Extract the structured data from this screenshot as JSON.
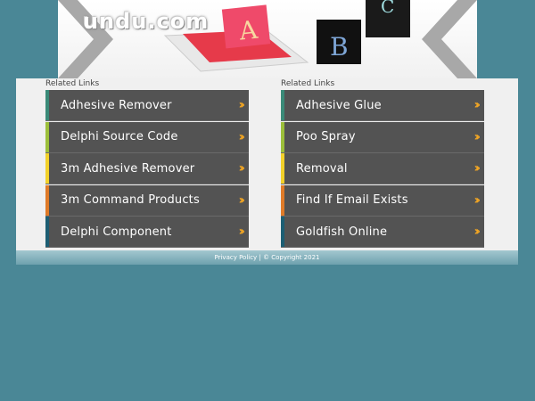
{
  "header": {
    "logo_text": "undu.com",
    "image_letters": [
      "A",
      "B",
      "C"
    ]
  },
  "columns": [
    {
      "label": "Related Links",
      "items": [
        {
          "label": "Adhesive Remover",
          "accent": "#3a8a78"
        },
        {
          "label": "Delphi Source Code",
          "accent": "#9cbf3a"
        },
        {
          "label": "3m Adhesive Remover",
          "accent": "#f2d12a"
        },
        {
          "label": "3m Command Products",
          "accent": "#e07b28"
        },
        {
          "label": "Delphi Component",
          "accent": "#1d5e73"
        }
      ]
    },
    {
      "label": "Related Links",
      "items": [
        {
          "label": "Adhesive Glue",
          "accent": "#3a8a78"
        },
        {
          "label": "Poo Spray",
          "accent": "#9cbf3a"
        },
        {
          "label": "Removal",
          "accent": "#f2d12a"
        },
        {
          "label": "Find If Email Exists",
          "accent": "#e07b28"
        },
        {
          "label": "Goldfish Online",
          "accent": "#1d5e73"
        }
      ]
    }
  ],
  "arrow_icon": "double-chevron-right-icon",
  "footer": {
    "text": "Privacy Policy | © Copyright 2021"
  },
  "colors": {
    "background": "#4a8796",
    "item_bg": "#535353",
    "arrow": "#f0a524"
  }
}
